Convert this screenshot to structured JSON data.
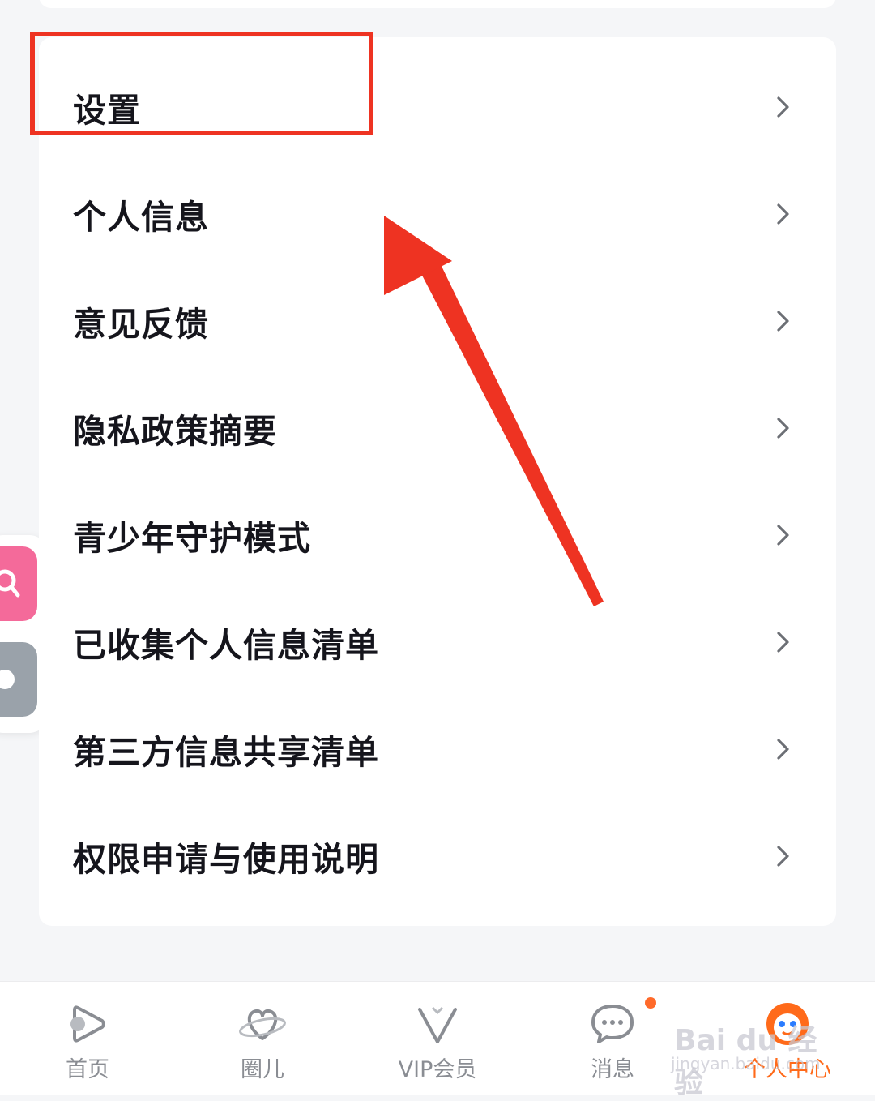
{
  "menu": {
    "items": [
      {
        "label": "设置"
      },
      {
        "label": "个人信息"
      },
      {
        "label": "意见反馈"
      },
      {
        "label": "隐私政策摘要"
      },
      {
        "label": "青少年守护模式"
      },
      {
        "label": "已收集个人信息清单"
      },
      {
        "label": "第三方信息共享清单"
      },
      {
        "label": "权限申请与使用说明"
      }
    ]
  },
  "annotation": {
    "color": "#ee3322"
  },
  "tabbar": {
    "tabs": [
      {
        "label": "首页",
        "icon": "play-icon",
        "active": false
      },
      {
        "label": "圈儿",
        "icon": "planet-heart-icon",
        "active": false
      },
      {
        "label": "VIP会员",
        "icon": "vip-crown-icon",
        "active": false
      },
      {
        "label": "消息",
        "icon": "message-bubble-icon",
        "active": false,
        "badge": true
      },
      {
        "label": "个人中心",
        "icon": "avatar-mascot-icon",
        "active": true
      }
    ],
    "active_color": "#ff6a1a",
    "inactive_color": "#8a8d93"
  },
  "watermark": {
    "logo": "Bai du 经验",
    "url": "jingyan.baidu.com"
  }
}
